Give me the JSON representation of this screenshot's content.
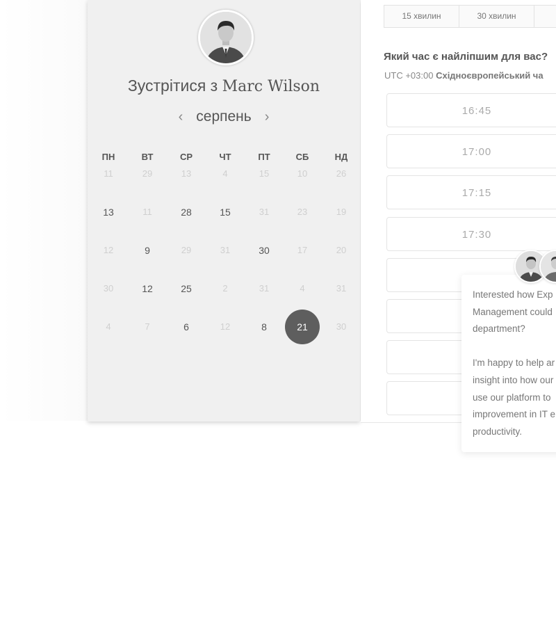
{
  "scheduler": {
    "title_prefix": "Зустрітися з",
    "host_name": "Marc Wilson",
    "month": "серпень",
    "prev_month_icon": "chevron-left-icon",
    "next_month_icon": "chevron-right-icon",
    "weekdays": [
      "ПН",
      "ВТ",
      "СР",
      "ЧТ",
      "ПТ",
      "СБ",
      "НД"
    ],
    "weeks": [
      [
        {
          "d": "11",
          "s": "muted"
        },
        {
          "d": "29",
          "s": "muted"
        },
        {
          "d": "13",
          "s": "muted"
        },
        {
          "d": "4",
          "s": "muted"
        },
        {
          "d": "15",
          "s": "muted"
        },
        {
          "d": "10",
          "s": "muted"
        },
        {
          "d": "26",
          "s": "muted"
        }
      ],
      [
        {
          "d": "13",
          "s": "avail"
        },
        {
          "d": "11",
          "s": "muted"
        },
        {
          "d": "28",
          "s": "avail"
        },
        {
          "d": "15",
          "s": "avail"
        },
        {
          "d": "31",
          "s": "muted"
        },
        {
          "d": "23",
          "s": "muted"
        },
        {
          "d": "19",
          "s": "muted"
        }
      ],
      [
        {
          "d": "12",
          "s": "muted"
        },
        {
          "d": "9",
          "s": "avail"
        },
        {
          "d": "29",
          "s": "muted"
        },
        {
          "d": "31",
          "s": "muted"
        },
        {
          "d": "30",
          "s": "avail"
        },
        {
          "d": "17",
          "s": "muted"
        },
        {
          "d": "20",
          "s": "muted"
        }
      ],
      [
        {
          "d": "30",
          "s": "muted"
        },
        {
          "d": "12",
          "s": "avail"
        },
        {
          "d": "25",
          "s": "avail"
        },
        {
          "d": "2",
          "s": "muted"
        },
        {
          "d": "31",
          "s": "muted"
        },
        {
          "d": "4",
          "s": "muted"
        },
        {
          "d": "31",
          "s": "muted"
        }
      ],
      [
        {
          "d": "4",
          "s": "muted"
        },
        {
          "d": "7",
          "s": "muted"
        },
        {
          "d": "6",
          "s": "avail"
        },
        {
          "d": "12",
          "s": "muted"
        },
        {
          "d": "8",
          "s": "avail"
        },
        {
          "d": "21",
          "s": "selected"
        },
        {
          "d": "30",
          "s": "muted"
        }
      ]
    ]
  },
  "booking": {
    "durations": [
      "15 хвилин",
      "30 хвилин",
      ""
    ],
    "question": "Який час є найліпшим для вас?",
    "timezone_offset": "UTC +03:00",
    "timezone_name": "Східноєвропейський ча",
    "slots": [
      "16:45",
      "17:00",
      "17:15",
      "17:30",
      "",
      "",
      "",
      ""
    ]
  },
  "chat": {
    "paragraph1": [
      "Interested how Exp",
      "Management could",
      "department?"
    ],
    "paragraph2": [
      "I'm happy to help ar",
      "insight into how our",
      "use our platform to",
      "improvement in IT e",
      "productivity."
    ]
  },
  "colors": {
    "selected_day_bg": "#5e5e5e",
    "panel_bg": "#f0f0f0",
    "muted_text": "#cfcfcf",
    "text": "#555555"
  }
}
